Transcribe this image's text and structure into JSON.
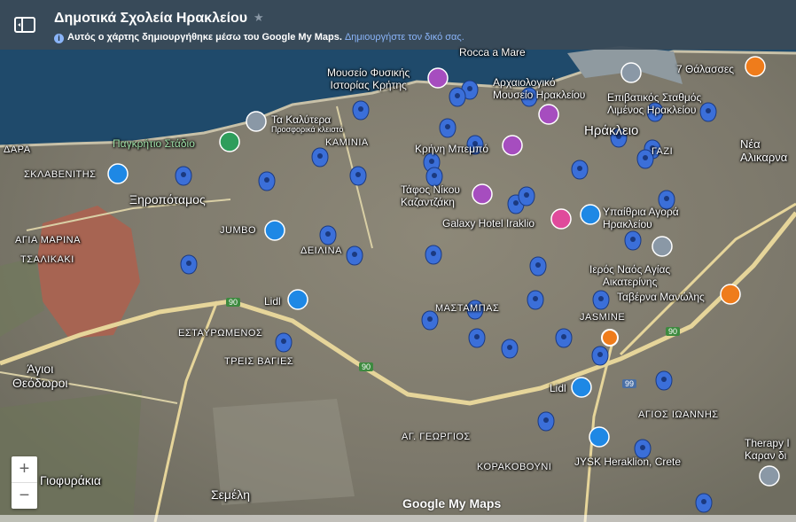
{
  "header": {
    "title": "Δημοτικά Σχολεία Ηρακλείου",
    "info_text": "Αυτός ο χάρτης δημιουργήθηκε μέσω του Google My Maps.",
    "info_link": "Δημιουργήστε τον δικό σας."
  },
  "map_labels": {
    "museum": "Μουσείο Φυσικής\nΙστορίας Κρήτης",
    "archaeo": "Αρχαιολογικό\nΜουσείο Ηρακλείου",
    "rocca": "Rocca a Mare",
    "seven_seas": "7 Θάλασσες",
    "port": "Επιβατικός Σταθμός\nΛιμένος Ηρακλείου",
    "kalytera": "Τα Καλύτερα",
    "kalytera_sub": "Προσφορικά κλειστό",
    "pagkritio": "Παγκρήτιο Στάδιο",
    "kaminia": "ΚΑΜΙΝΙΑ",
    "iraklio": "Ηράκλειο",
    "nea_alik": "Νέα\nΑλικαρνα",
    "dara": "ΔΑΡΑ",
    "sklav": "ΣΚΛΑΒΕΝΙΤΗΣ",
    "xerop": "Ξηροπόταμος",
    "krini": "Κρήνη Μπεμπό",
    "gazi": "ΓΑΖΙ",
    "tafos": "Τάφος Νίκου\nΚαζαντζάκη",
    "galaxy": "Galaxy Hotel Iraklio",
    "ypaithria": "Υπαίθρια Αγορά\nΗρακλείου",
    "agia_marina": "ΑΓΙΑ ΜΑΡΙΝΑ",
    "tsalikaki": "ΤΣΑΛΙΚΑΚΙ",
    "jumbo": "JUMBO",
    "deilina": "ΔΕΙΛΙΝΑ",
    "ieros_naos": "Ιερός Ναός Αγίας\nΑικατερίνης",
    "taverna": "Ταβέρνα Μανώλης",
    "lidl1": "Lidl",
    "mastampas": "ΜΑΣΤΑΜΠΑΣ",
    "jasmine": "JASMINE",
    "estavromenos": "ΕΣΤΑΥΡΩΜΕΝΟΣ",
    "treis_vagies": "ΤΡΕΙΣ ΒΑΓΙΕΣ",
    "agioi": "Άγιοι\nΘεόδωροι",
    "lidl2": "Lidl",
    "agios_ioannis": "ΑΓΙΟΣ ΙΩΑΝΝΗΣ",
    "ag_georgios": "ΑΓ. ΓΕΩΡΓΙΟΣ",
    "korakovouni": "ΚΟΡΑΚΟΒΟΥΝΙ",
    "jysk": "JYSK Heraklion, Crete",
    "therapy": "Therapy I\nΚαραν δι",
    "giofyrakia": "Γιοφυράκια",
    "semeli": "Σεμέλη",
    "road_90a": "90",
    "road_90b": "90",
    "road_90c": "90",
    "road_99": "99"
  },
  "zoom": {
    "in": "+",
    "out": "−"
  },
  "attribution": {
    "logo": "Google My Maps"
  },
  "markers": {
    "school_count": 34,
    "school_color": "#3b6fd9",
    "poi_colors": {
      "shopping": "#1e88e5",
      "museum": "#a64dbf",
      "food": "#ef7c1b",
      "hotel": "#e04a9b",
      "stadium": "#2e9d5b",
      "religion": "#8a98a6"
    }
  }
}
